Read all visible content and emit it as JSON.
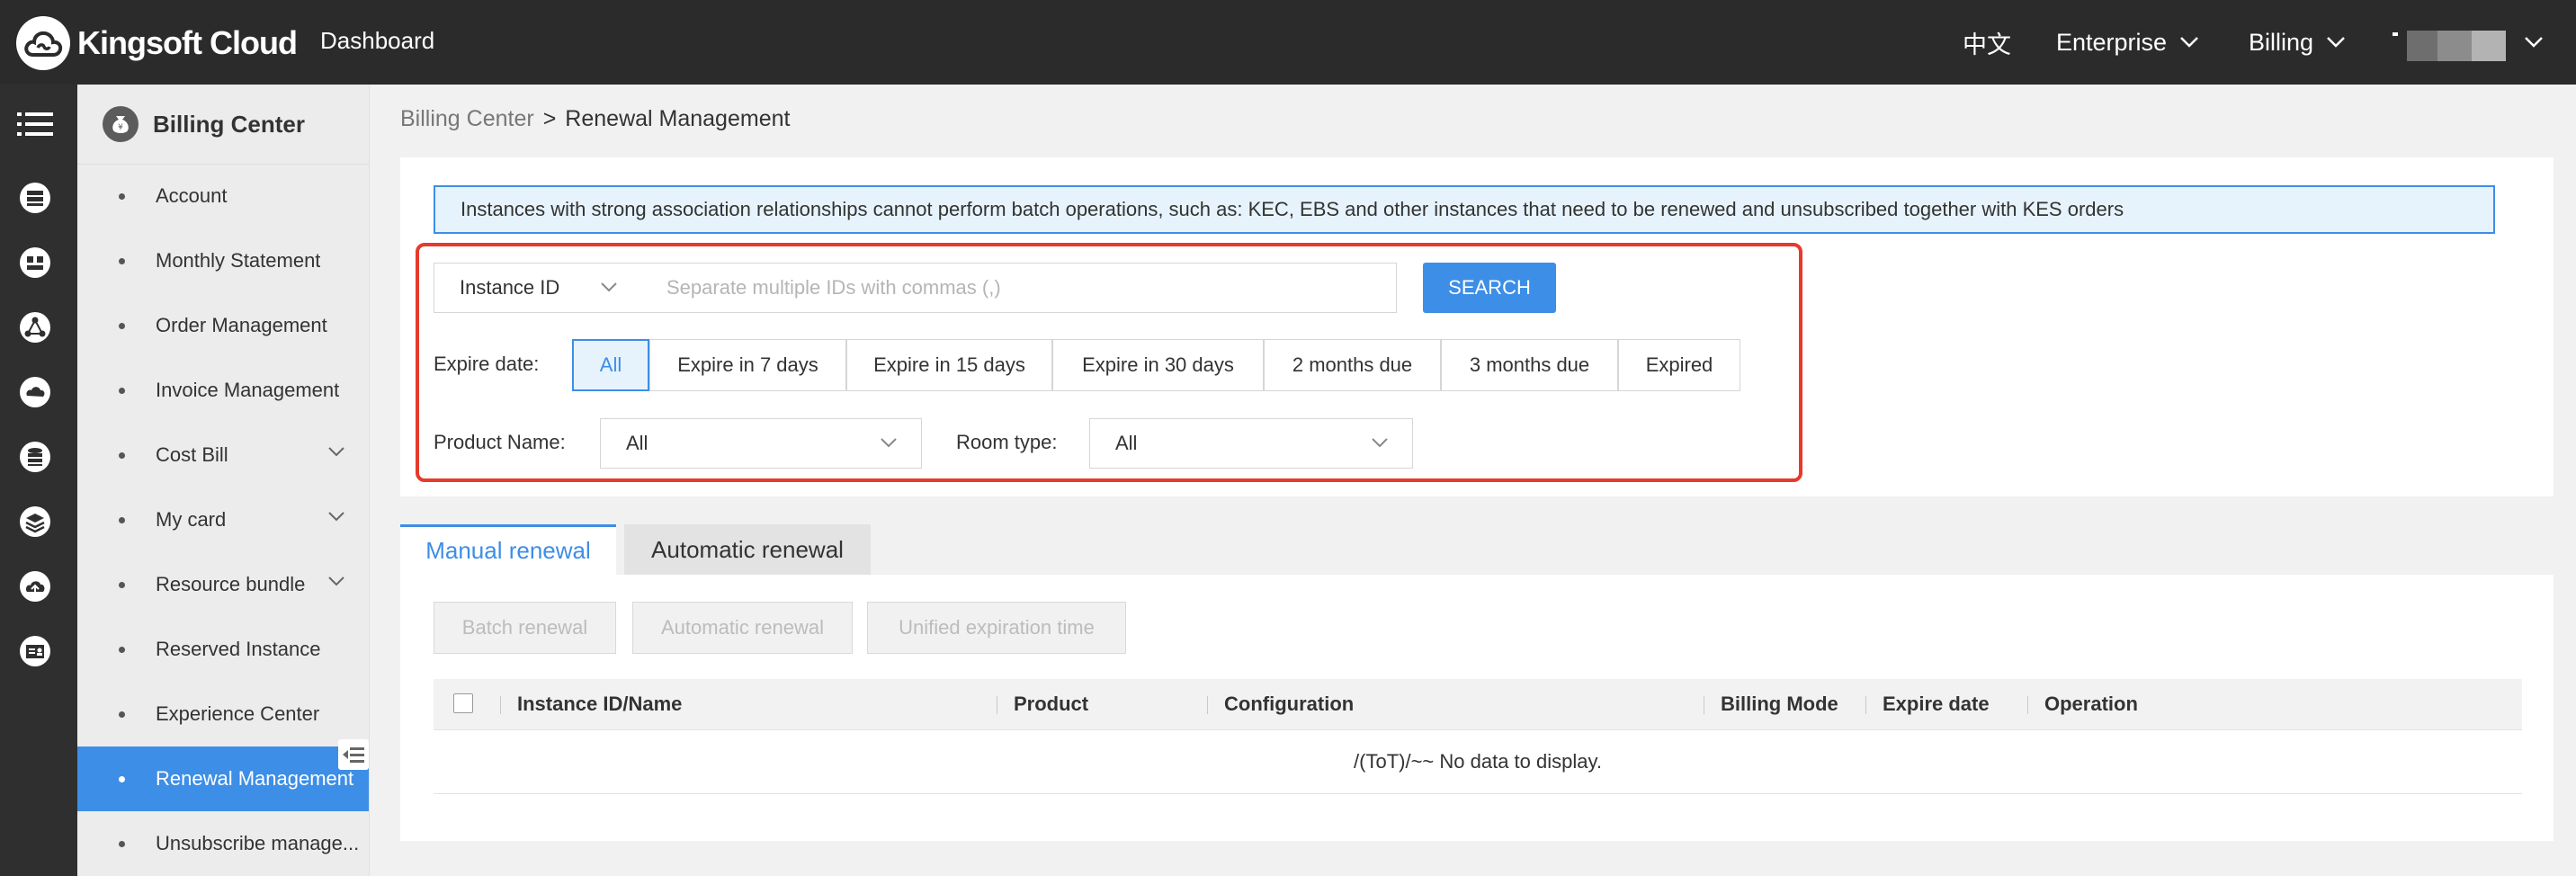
{
  "header": {
    "brand": "Kingsoft Cloud",
    "dashboard": "Dashboard",
    "language": "中文",
    "enterprise": "Enterprise",
    "billing": "Billing"
  },
  "rail": {
    "icons": [
      "menu-icon",
      "database-icon",
      "gallery-icon",
      "network-icon",
      "cloud-sync-icon",
      "storage-icon",
      "layers-icon",
      "cloud-upload-icon",
      "id-card-icon"
    ]
  },
  "sidebar": {
    "title": "Billing Center",
    "items": [
      {
        "label": "Account"
      },
      {
        "label": "Monthly Statement"
      },
      {
        "label": "Order Management"
      },
      {
        "label": "Invoice Management"
      },
      {
        "label": "Cost Bill"
      },
      {
        "label": "My card"
      },
      {
        "label": "Resource bundle"
      },
      {
        "label": "Reserved Instance"
      },
      {
        "label": "Experience Center"
      },
      {
        "label": "Renewal Management"
      },
      {
        "label": "Unsubscribe manage..."
      }
    ]
  },
  "breadcrumb": {
    "parent": "Billing Center",
    "separator": ">",
    "current": "Renewal Management"
  },
  "notice": "Instances with strong association relationships cannot perform batch operations, such as: KEC, EBS and other instances that need to be renewed and unsubscribed together with KES orders",
  "filters": {
    "id_type": "Instance ID",
    "id_placeholder": "Separate multiple IDs with commas (,)",
    "search_label": "SEARCH",
    "expire_label": "Expire date:",
    "expire_options": [
      "All",
      "Expire in 7 days",
      "Expire in 15 days",
      "Expire in 30 days",
      "2 months due",
      "3 months due",
      "Expired"
    ],
    "product_label": "Product Name:",
    "product_value": "All",
    "room_label": "Room type:",
    "room_value": "All"
  },
  "tabs": {
    "manual": "Manual renewal",
    "automatic": "Automatic renewal"
  },
  "actions": {
    "batch": "Batch renewal",
    "automatic": "Automatic renewal",
    "unified": "Unified expiration time"
  },
  "table": {
    "columns": [
      "Instance ID/Name",
      "Product",
      "Configuration",
      "Billing Mode",
      "Expire date",
      "Operation"
    ],
    "empty": "/(ToT)/~~ No data to display."
  },
  "colors": {
    "accent": "#3d8ee6",
    "highlight": "#e53a2c",
    "topbar": "#2b2b2b"
  }
}
